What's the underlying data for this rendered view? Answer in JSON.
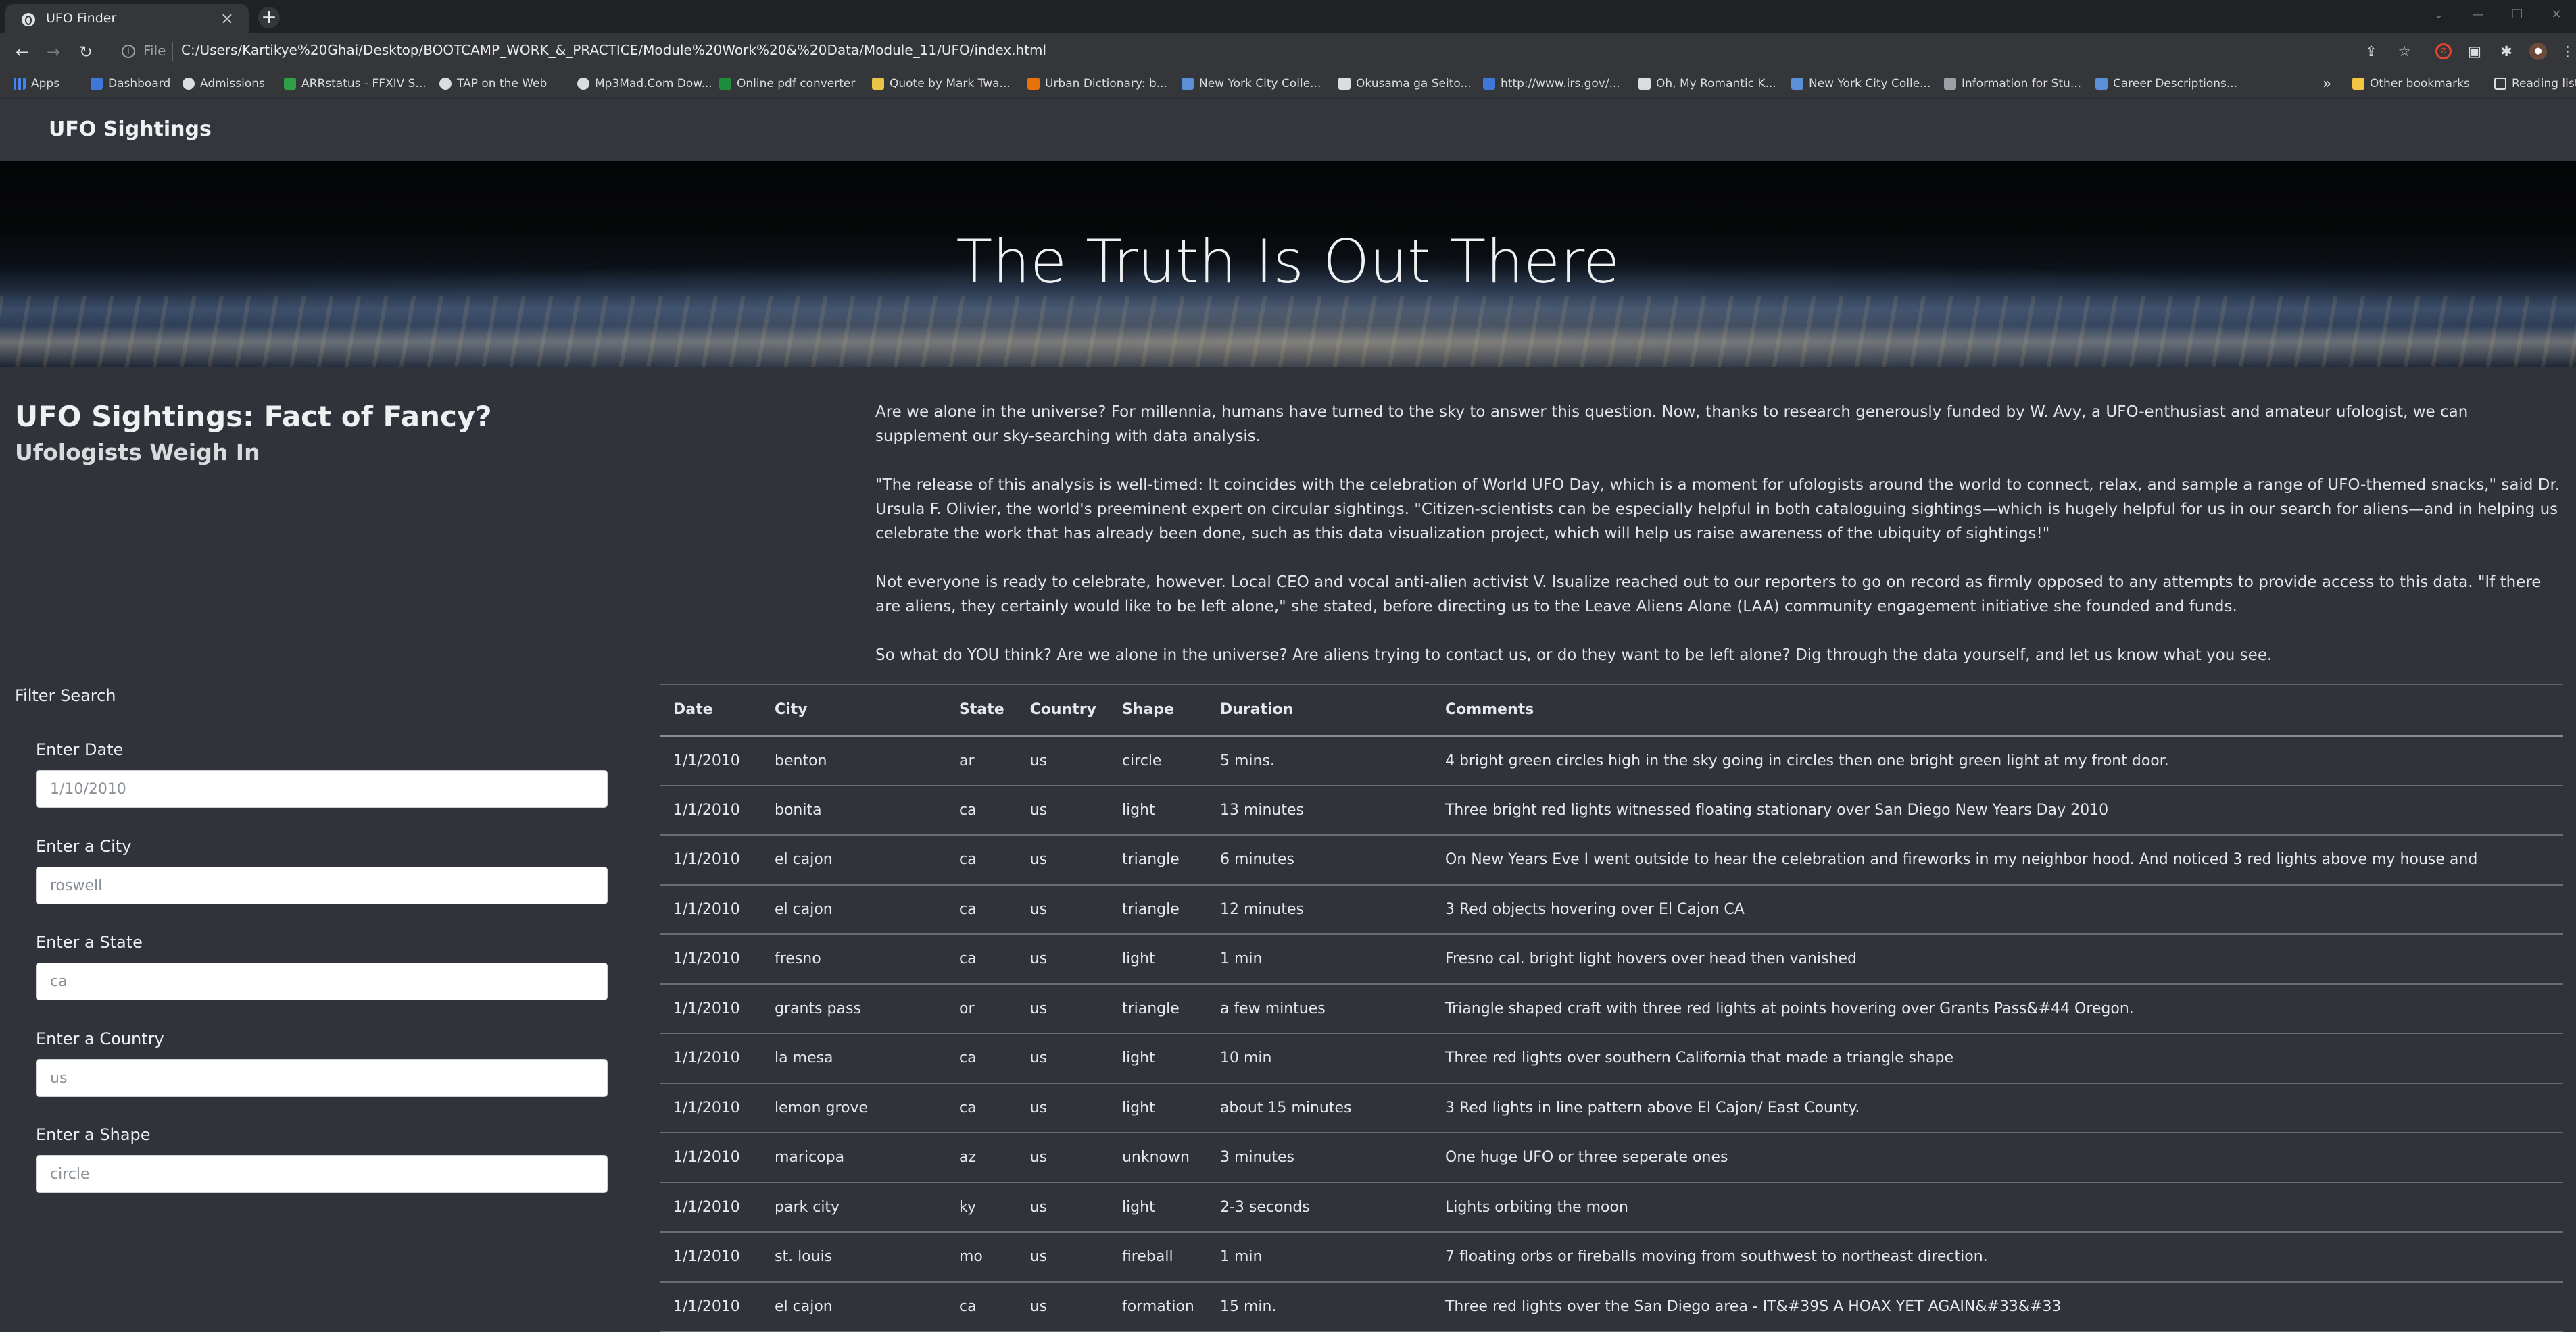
{
  "browser": {
    "tab_title": "UFO Finder",
    "file_label": "File",
    "url": "C:/Users/Kartikye%20Ghai/Desktop/BOOTCAMP_WORK_&_PRACTICE/Module%20Work%20&%20Data/Module_11/UFO/index.html",
    "bookmarks": [
      {
        "label": "Apps",
        "color": "#4285f4"
      },
      {
        "label": "Dashboard",
        "color": "#3c78d8"
      },
      {
        "label": "Admissions",
        "color": "#dadce0"
      },
      {
        "label": "ARRstatus - FFXIV S...",
        "color": "#2f9e44"
      },
      {
        "label": "TAP on the Web",
        "color": "#dadce0"
      },
      {
        "label": "Mp3Mad.Com Dow...",
        "color": "#dadce0"
      },
      {
        "label": "Online pdf converter",
        "color": "#1e8e3e"
      },
      {
        "label": "Quote by Mark Twa...",
        "color": "#e8c547"
      },
      {
        "label": "Urban Dictionary: b...",
        "color": "#e8710a"
      },
      {
        "label": "New York City Colle...",
        "color": "#5b8fd6"
      },
      {
        "label": "Okusama ga Seito...",
        "color": "#dadce0"
      },
      {
        "label": "http://www.irs.gov/...",
        "color": "#3c78d8"
      },
      {
        "label": "Oh, My Romantic K...",
        "color": "#dadce0"
      },
      {
        "label": "New York City Colle...",
        "color": "#5b8fd6"
      },
      {
        "label": "Information for Stu...",
        "color": "#9aa0a6"
      },
      {
        "label": "Career Descriptions...",
        "color": "#5b8fd6"
      }
    ],
    "overflow": "»",
    "other_bookmarks": "Other bookmarks",
    "reading_list": "Reading list"
  },
  "navbar": {
    "brand": "UFO Sightings"
  },
  "hero": {
    "title": "The Truth Is Out There"
  },
  "intro": {
    "heading": "UFO Sightings: Fact of Fancy?",
    "subheading": "Ufologists Weigh In",
    "paragraphs": [
      "Are we alone in the universe? For millennia, humans have turned to the sky to answer this question. Now, thanks to research generously funded by W. Avy, a UFO-enthusiast and amateur ufologist, we can supplement our sky-searching with data analysis.",
      "\"The release of this analysis is well-timed: It coincides with the celebration of World UFO Day, which is a moment for ufologists around the world to connect, relax, and sample a range of UFO-themed snacks,\" said Dr. Ursula F. Olivier, the world's preeminent expert on circular sightings. \"Citizen-scientists can be especially helpful in both cataloguing sightings—which is hugely helpful for us in our search for aliens—and in helping us celebrate the work that has already been done, such as this data visualization project, which will help us raise awareness of the ubiquity of sightings!\"",
      "Not everyone is ready to celebrate, however. Local CEO and vocal anti-alien activist V. Isualize reached out to our reporters to go on record as firmly opposed to any attempts to provide access to this data. \"If there are aliens, they certainly would like to be left alone,\" she stated, before directing us to the Leave Aliens Alone (LAA) community engagement initiative she founded and funds.",
      "So what do YOU think? Are we alone in the universe? Are aliens trying to contact us, or do they want to be left alone? Dig through the data yourself, and let us know what you see."
    ]
  },
  "filters": {
    "title": "Filter Search",
    "fields": [
      {
        "label": "Enter Date",
        "placeholder": "1/10/2010"
      },
      {
        "label": "Enter a City",
        "placeholder": "roswell"
      },
      {
        "label": "Enter a State",
        "placeholder": "ca"
      },
      {
        "label": "Enter a Country",
        "placeholder": "us"
      },
      {
        "label": "Enter a Shape",
        "placeholder": "circle"
      }
    ]
  },
  "table": {
    "headers": [
      "Date",
      "City",
      "State",
      "Country",
      "Shape",
      "Duration",
      "Comments"
    ],
    "rows": [
      [
        "1/1/2010",
        "benton",
        "ar",
        "us",
        "circle",
        "5 mins.",
        "4 bright green circles high in the sky going in circles then one bright green light at my front door."
      ],
      [
        "1/1/2010",
        "bonita",
        "ca",
        "us",
        "light",
        "13 minutes",
        "Three bright red lights witnessed floating stationary over San Diego New Years Day 2010"
      ],
      [
        "1/1/2010",
        "el cajon",
        "ca",
        "us",
        "triangle",
        "6 minutes",
        "On New Years Eve I went outside to hear the celebration and fireworks in my neighbor hood. And noticed 3 red lights above my house and"
      ],
      [
        "1/1/2010",
        "el cajon",
        "ca",
        "us",
        "triangle",
        "12 minutes",
        "3 Red objects hovering over El Cajon CA"
      ],
      [
        "1/1/2010",
        "fresno",
        "ca",
        "us",
        "light",
        "1 min",
        "Fresno cal. bright light hovers over head then vanished"
      ],
      [
        "1/1/2010",
        "grants pass",
        "or",
        "us",
        "triangle",
        "a few mintues",
        "Triangle shaped craft with three red lights at points hovering over Grants Pass&#44 Oregon."
      ],
      [
        "1/1/2010",
        "la mesa",
        "ca",
        "us",
        "light",
        "10 min",
        "Three red lights over southern California that made a triangle shape"
      ],
      [
        "1/1/2010",
        "lemon grove",
        "ca",
        "us",
        "light",
        "about 15 minutes",
        "3 Red lights in line pattern above El Cajon/ East County."
      ],
      [
        "1/1/2010",
        "maricopa",
        "az",
        "us",
        "unknown",
        "3 minutes",
        "One huge UFO or three seperate ones"
      ],
      [
        "1/1/2010",
        "park city",
        "ky",
        "us",
        "light",
        "2-3 seconds",
        "Lights orbiting the moon"
      ],
      [
        "1/1/2010",
        "st. louis",
        "mo",
        "us",
        "fireball",
        "1 min",
        "7 floating orbs or fireballs moving from southwest to northeast direction."
      ],
      [
        "1/1/2010",
        "el cajon",
        "ca",
        "us",
        "formation",
        "15 min.",
        "Three red lights over the San Diego area - IT&#39S A HOAX YET AGAIN&#33&#33"
      ]
    ]
  }
}
